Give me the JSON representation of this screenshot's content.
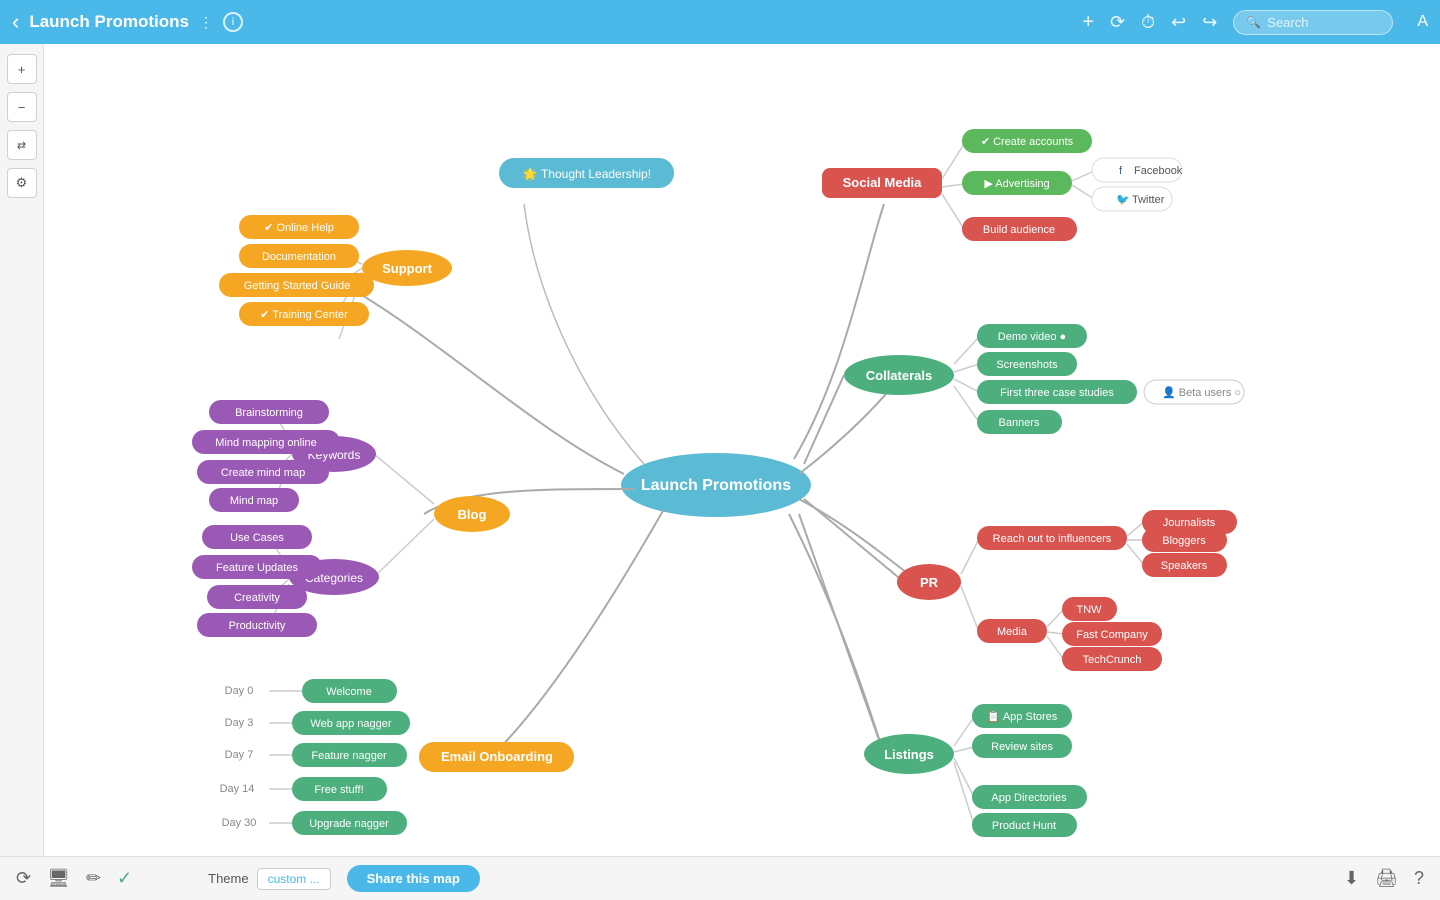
{
  "header": {
    "title": "Launch Promotions",
    "title_arrow": "⋮",
    "info_icon": "i",
    "back_icon": "‹",
    "search_placeholder": "Search",
    "font_icon": "A"
  },
  "toolbar": {
    "add": "+",
    "history1": "⟳",
    "time": "⏱",
    "undo": "↩",
    "redo": "↪"
  },
  "sidebar": {
    "zoom_in": "+",
    "zoom_out": "−",
    "shuffle": "⇄",
    "settings": "⚙"
  },
  "mindmap": {
    "center": "Launch Promotions",
    "nodes": {
      "thought_leadership": "Thought Leadership!",
      "support": "Support",
      "online_help": "✔ Online Help",
      "documentation": "Documentation",
      "getting_started": "Getting Started Guide",
      "training_center": "✔ Training Center",
      "blog": "Blog",
      "keywords": "Keywords",
      "brainstorming": "Brainstorming",
      "mind_mapping_online": "Mind mapping online",
      "create_mind_map": "Create mind map",
      "mind_map": "Mind map",
      "categories": "Categories",
      "use_cases": "Use Cases",
      "feature_updates": "Feature Updates",
      "creativity": "Creativity",
      "productivity": "Productivity",
      "email_onboarding": "Email Onboarding",
      "day0": "Day 0",
      "welcome": "Welcome",
      "day3": "Day 3",
      "web_app_nagger": "Web app nagger",
      "day7": "Day 7",
      "feature_nagger": "Feature nagger",
      "day14": "Day 14",
      "free_stuff": "Free stuff!",
      "day30": "Day 30",
      "upgrade_nagger": "Upgrade nagger",
      "social_media": "Social Media",
      "create_accounts": "✔ Create accounts",
      "advertising": "▶ Advertising",
      "facebook": "Facebook",
      "twitter": "Twitter",
      "build_audience": "Build audience",
      "collaterals": "Collaterals",
      "demo_video": "Demo video ●",
      "screenshots": "Screenshots",
      "first_three_case_studies": "First three case studies",
      "beta_users": "Beta users ○",
      "banners": "Banners",
      "pr": "PR",
      "reach_out": "Reach out to influencers",
      "journalists": "Journalists",
      "bloggers": "Bloggers",
      "speakers": "Speakers",
      "media": "Media",
      "tnw": "TNW",
      "fast_company": "Fast Company",
      "techcrunch": "TechCrunch",
      "listings": "Listings",
      "app_stores": "App Stores",
      "review_sites": "Review sites",
      "app_directories": "App Directories",
      "product_hunt": "Product Hunt"
    }
  },
  "bottom": {
    "share_label": "Share this map",
    "theme_label": "Theme",
    "theme_value": "custom ..."
  }
}
